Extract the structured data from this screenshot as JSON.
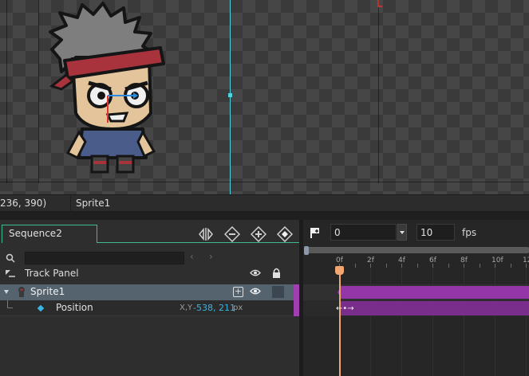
{
  "viewport": {
    "accent_cyan": "#4fd3e0",
    "accent_red": "#e0342c"
  },
  "statusbar": {
    "coords": "236, 390)",
    "selected": "Sprite1"
  },
  "sequence_panel": {
    "tab_label": "Sequence2",
    "toolbar_icons": [
      "mirror-icon",
      "minus-circle-icon",
      "plus-circle-icon",
      "record-icon"
    ],
    "track_panel_label": "Track Panel",
    "search": {
      "value": ""
    },
    "tracks": [
      {
        "label": "Sprite1",
        "selected": true
      },
      {
        "label": "Position",
        "xy_label": "X,Y",
        "value": "-538, 211",
        "unit": "px"
      }
    ]
  },
  "timeline": {
    "frame_value": "0",
    "fps_value": "10",
    "fps_label": "fps",
    "ticks": [
      "0f",
      "2f",
      "4f",
      "6f",
      "8f",
      "10f",
      "12"
    ],
    "current_frame": 0,
    "track_color": "#9436a8",
    "playhead_color": "#f2a672"
  }
}
